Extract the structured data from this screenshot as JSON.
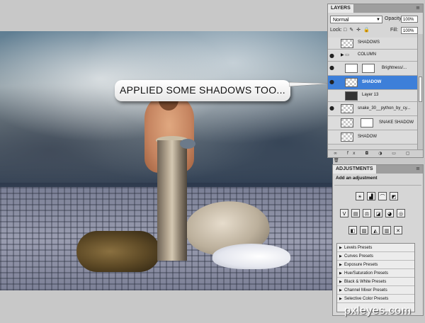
{
  "canvas": {
    "callout_text": "APPLIED SOME SHADOWS TOO..."
  },
  "layers_panel": {
    "tab": "LAYERS",
    "blend_mode": "Normal",
    "opacity_label": "Opacity:",
    "opacity_value": "100%",
    "lock_label": "Lock:",
    "fill_label": "Fill:",
    "fill_value": "100%",
    "layers": [
      {
        "name": "SHADOWS",
        "visible": false,
        "selected": false
      },
      {
        "name": "COLUMN",
        "visible": true,
        "selected": false
      },
      {
        "name": "Brightness/...",
        "visible": true,
        "selected": false
      },
      {
        "name": "SHADOW",
        "visible": true,
        "selected": true
      },
      {
        "name": "Layer 13",
        "visible": false,
        "selected": false
      },
      {
        "name": "snake_30__python_by_cy...",
        "visible": true,
        "selected": false
      },
      {
        "name": "SNAKE SHADOW",
        "visible": false,
        "selected": false
      },
      {
        "name": "SHADOW",
        "visible": false,
        "selected": false
      }
    ]
  },
  "adjustments_panel": {
    "tab": "ADJUSTMENTS",
    "heading": "Add an adjustment",
    "presets": [
      "Levels Presets",
      "Curves Presets",
      "Exposure Presets",
      "Hue/Saturation Presets",
      "Black & White Presets",
      "Channel Mixer Presets",
      "Selective Color Presets"
    ]
  },
  "watermark": "pxleyes.com",
  "colors": {
    "selection": "#3d7fd9",
    "panel_bg": "#d6d6d6"
  }
}
